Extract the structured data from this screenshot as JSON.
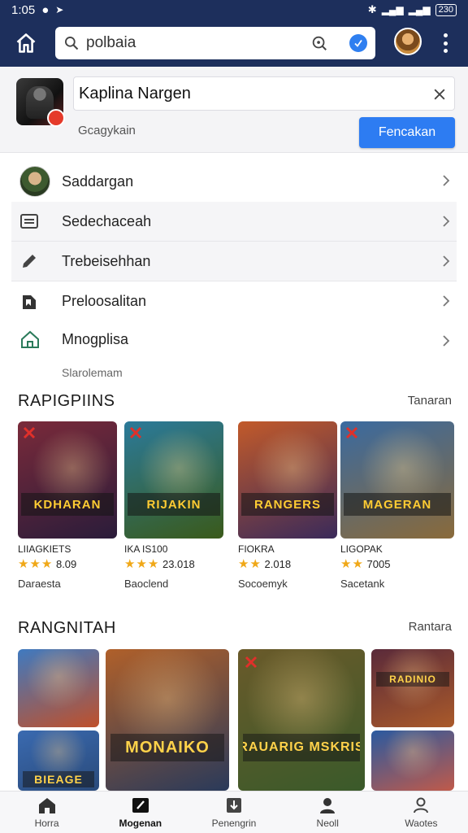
{
  "status_bar": {
    "time": "1:05",
    "battery": "230"
  },
  "search": {
    "query": "polbaia"
  },
  "notification": {
    "title": "Kaplina Nargen",
    "subtitle": "Gcagykain",
    "action_label": "Fencakan"
  },
  "menu": {
    "items": [
      {
        "label": "Saddargan",
        "icon": "profile-avatar-icon"
      },
      {
        "label": "Sedechaceah",
        "icon": "list-icon"
      },
      {
        "label": "Trebeisehhan",
        "icon": "pencil-icon"
      },
      {
        "label": "Preloosalitan",
        "icon": "book-icon"
      },
      {
        "label": "Mnogplisa",
        "icon": "house-icon"
      }
    ],
    "footnote": "Slarolemam"
  },
  "section1": {
    "title": "RAPIGPIINS",
    "more": "Tanaran",
    "cards": [
      {
        "art_text": "KDHARAN",
        "meta": "LIIAGKIETS",
        "stars": "★★★",
        "rating": "8.09",
        "dev": "Daraesta",
        "bg": "#7a2a3a",
        "bg2": "#2a1c3a"
      },
      {
        "art_text": "RIJAKIN",
        "meta": "IKA IS100",
        "stars": "★★★",
        "rating": "23.018",
        "dev": "Baoclend",
        "bg": "#2b7a9a",
        "bg2": "#3a5a1a"
      },
      {
        "art_text": "RANGERS",
        "meta": "FIOKRA",
        "stars": "★★",
        "rating": "2.018",
        "dev": "Socoemyk",
        "bg": "#c25a2a",
        "bg2": "#3a2a5a"
      },
      {
        "art_text": "MAGERAN",
        "meta": "LIGOPAK",
        "stars": "★★",
        "rating": "7005",
        "dev": "Sacetank",
        "bg": "#3a6aa0",
        "bg2": "#8a6a3a"
      }
    ]
  },
  "section2": {
    "title": "RANGNITAH",
    "more": "Rantara",
    "tiles": [
      {
        "art_text": "",
        "bg": "#3f7ac0",
        "bg2": "#c0502a"
      },
      {
        "art_text": "BIEAGE",
        "bg": "#3a6ab0",
        "bg2": "#2a4a7a"
      },
      {
        "art_text": "MONAIKO",
        "bg": "#b0602a",
        "bg2": "#2a3a5a"
      },
      {
        "art_text": "RAUARIG MSKRIS",
        "bg": "#6a5a2a",
        "bg2": "#3a5a2a"
      },
      {
        "art_text": "RADINIO",
        "bg": "#5a2a3a",
        "bg2": "#aa5a2a"
      },
      {
        "art_text": "",
        "bg": "#2a5aa0",
        "bg2": "#c05a4a"
      }
    ]
  },
  "bottom_nav": [
    {
      "label": "Horra",
      "icon": "home-icon"
    },
    {
      "label": "Mogenan",
      "icon": "edit-icon"
    },
    {
      "label": "Penengrin",
      "icon": "download-icon"
    },
    {
      "label": "Neoll",
      "icon": "person-icon"
    },
    {
      "label": "Waotes",
      "icon": "people-icon"
    }
  ],
  "colors": {
    "app_bar": "#1d2f5c",
    "accent": "#2d7cf2",
    "star": "#f0a818"
  }
}
